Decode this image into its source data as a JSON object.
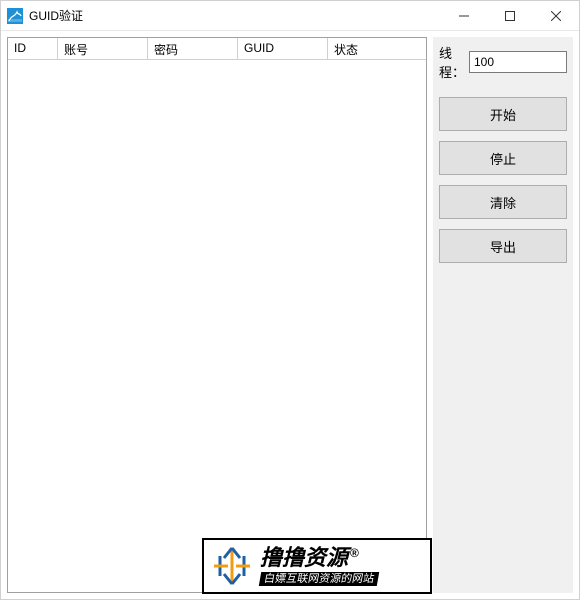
{
  "window": {
    "title": "GUID验证"
  },
  "table": {
    "columns": [
      "ID",
      "账号",
      "密码",
      "GUID",
      "状态"
    ],
    "widths": [
      50,
      90,
      90,
      90,
      80
    ],
    "rows": []
  },
  "side": {
    "thread_label": "线程：",
    "thread_value": "100",
    "buttons": {
      "start": "开始",
      "stop": "停止",
      "clear": "清除",
      "export": "导出"
    }
  },
  "watermark": {
    "brand": "撸撸资源",
    "reg": "®",
    "tagline": "白嫖互联网资源的网站"
  }
}
